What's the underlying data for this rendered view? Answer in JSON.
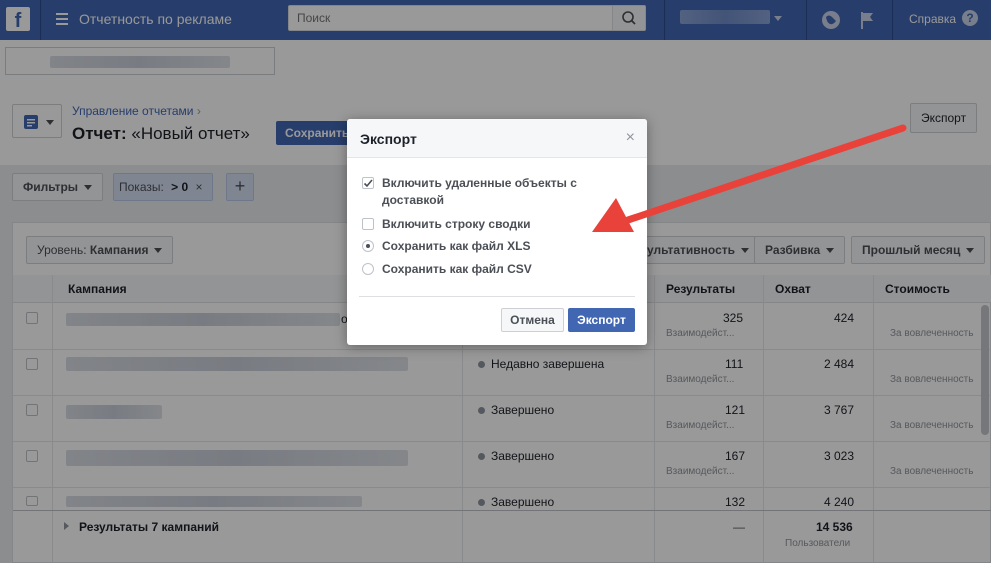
{
  "topbar": {
    "app_title": "Отчетность по рекламе",
    "search_placeholder": "Поиск",
    "help": "Справка",
    "help_icon": "?"
  },
  "header": {
    "breadcrumb": "Управление отчетами",
    "breadcrumb_sep": "›",
    "report_label": "Отчет:",
    "report_name": "«Новый отчет»",
    "save_button": "Сохранить",
    "export_button": "Экспорт"
  },
  "filters": {
    "filters_button": "Фильтры",
    "impressions_label": "Показы:",
    "impressions_value": "> 0",
    "remove_icon": "×",
    "add_icon": "+"
  },
  "toolbar": {
    "level_label": "Уровень:",
    "level_value": "Кампания",
    "performance_button": "ультативность",
    "breakdown_button": "Разбивка",
    "date_button": "Прошлый месяц"
  },
  "table": {
    "columns": {
      "campaign": "Кампания",
      "results": "Результаты",
      "reach": "Охват",
      "cost": "Стоимость"
    },
    "rows": [
      {
        "status": "",
        "results": "325",
        "results_sub": "Взаимодейст...",
        "reach": "424",
        "cost_sub": "За вовлеченность",
        "tail": "о"
      },
      {
        "status": "Недавно завершена",
        "results": "111",
        "results_sub": "Взаимодейст...",
        "reach": "2 484",
        "cost_sub": "За вовлеченность"
      },
      {
        "status": "Завершено",
        "results": "121",
        "results_sub": "Взаимодейст...",
        "reach": "3 767",
        "cost_sub": "За вовлеченность"
      },
      {
        "status": "Завершено",
        "results": "167",
        "results_sub": "Взаимодейст...",
        "reach": "3 023",
        "cost_sub": "За вовлеченность"
      },
      {
        "status": "Завершено",
        "results": "132",
        "reach": "4 240"
      }
    ],
    "summary": {
      "label": "Результаты 7 кампаний",
      "results": "—",
      "reach": "14 536",
      "reach_sub": "Пользователи"
    }
  },
  "modal": {
    "title": "Экспорт",
    "close": "×",
    "option_deleted": "Включить удаленные объекты с доставкой",
    "option_summary": "Включить строку сводки",
    "option_xls": "Сохранить как файл XLS",
    "option_csv": "Сохранить как файл CSV",
    "deleted_checked": true,
    "summary_checked": false,
    "format_selected": "xls",
    "cancel_button": "Отмена",
    "export_button": "Экспорт"
  },
  "colors": {
    "brand": "#4267b2",
    "arrow": "#e8423a"
  }
}
